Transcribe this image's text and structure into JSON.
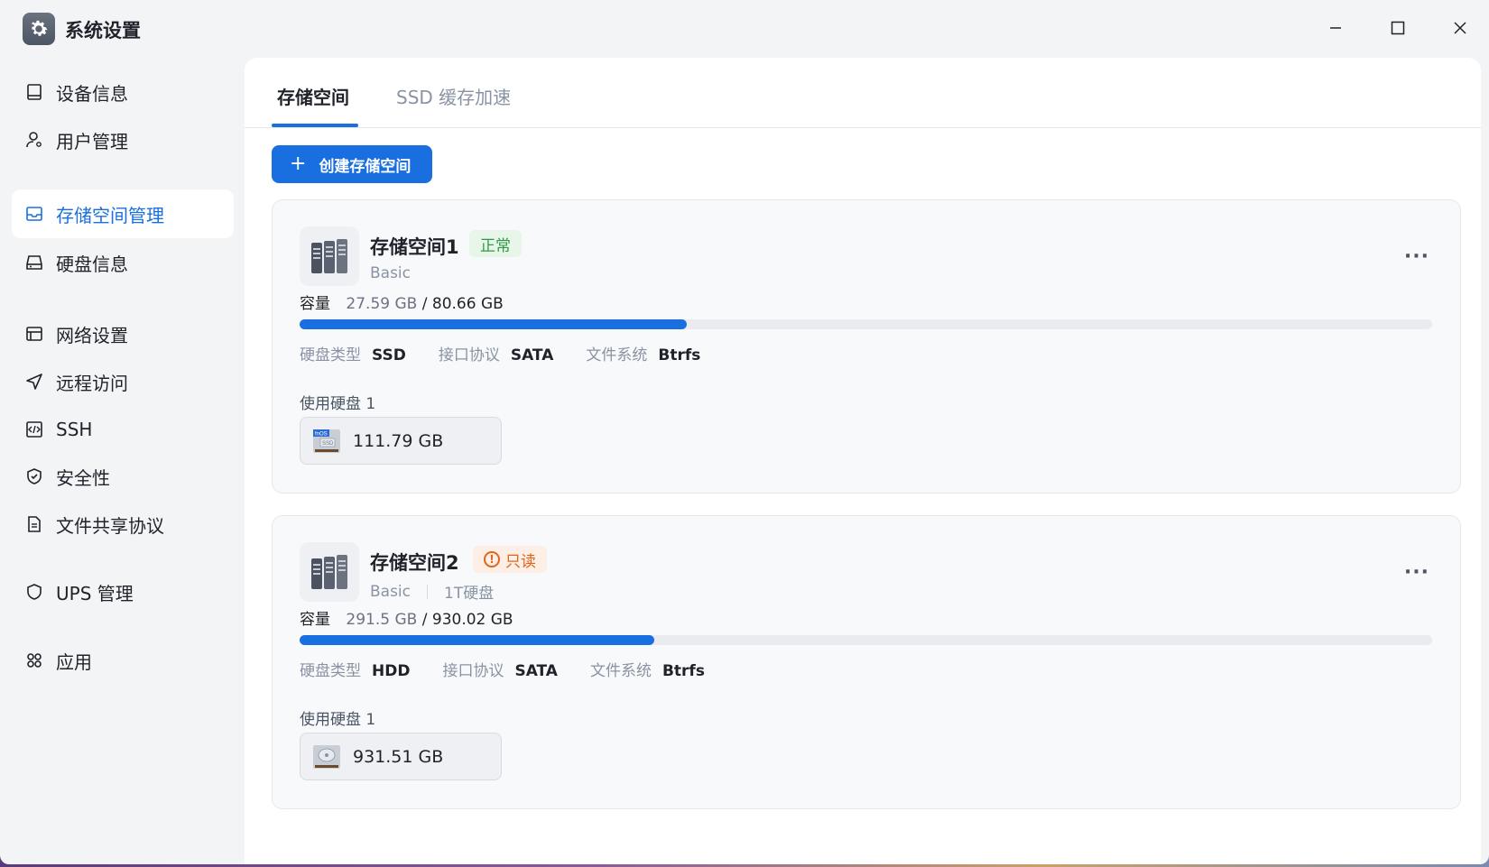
{
  "window": {
    "title": "系统设置",
    "icons": {
      "app": "gear-icon",
      "minimize": "minimize-icon",
      "maximize": "maximize-icon",
      "close": "close-icon"
    }
  },
  "sidebar": {
    "items": [
      {
        "label": "设备信息",
        "icon": "device-icon",
        "active": false
      },
      {
        "label": "用户管理",
        "icon": "user-icon",
        "active": false
      },
      {
        "label": "存储空间管理",
        "icon": "storage-icon",
        "active": true
      },
      {
        "label": "硬盘信息",
        "icon": "harddisk-icon",
        "active": false
      },
      {
        "label": "网络设置",
        "icon": "network-icon",
        "active": false
      },
      {
        "label": "远程访问",
        "icon": "send-icon",
        "active": false
      },
      {
        "label": "SSH",
        "icon": "code-icon",
        "active": false
      },
      {
        "label": "安全性",
        "icon": "shield-check-icon",
        "active": false
      },
      {
        "label": "文件共享协议",
        "icon": "document-icon",
        "active": false
      },
      {
        "label": "UPS 管理",
        "icon": "shield-icon",
        "active": false
      },
      {
        "label": "应用",
        "icon": "apps-icon",
        "active": false
      }
    ]
  },
  "tabs": [
    {
      "label": "存储空间",
      "active": true
    },
    {
      "label": "SSD 缓存加速",
      "active": false
    }
  ],
  "create_button": {
    "icon": "plus-icon",
    "label": "创建存储空间"
  },
  "pools": [
    {
      "name": "存储空间1",
      "status": "正常",
      "status_color": "#2f9a45",
      "raid": "Basic",
      "extra": "",
      "capacity_label": "容量",
      "used": "27.59 GB",
      "separator": "/",
      "total": "80.66 GB",
      "usage_fraction": 0.342,
      "specs": [
        {
          "k": "硬盘类型",
          "v": "SSD"
        },
        {
          "k": "接口协议",
          "v": "SATA"
        },
        {
          "k": "文件系统",
          "v": "Btrfs"
        }
      ],
      "disk_count_label": "使用硬盘 1",
      "disk": {
        "size": "111.79 GB",
        "icon": "ssd-icon",
        "icon_text": "fnOS SSD"
      },
      "more": "···"
    },
    {
      "name": "存储空间2",
      "status": "只读",
      "status_color": "#e0651b",
      "raid": "Basic",
      "extra": "1T硬盘",
      "capacity_label": "容量",
      "used": "291.5 GB",
      "separator": "/",
      "total": "930.02 GB",
      "usage_fraction": 0.313,
      "specs": [
        {
          "k": "硬盘类型",
          "v": "HDD"
        },
        {
          "k": "接口协议",
          "v": "SATA"
        },
        {
          "k": "文件系统",
          "v": "Btrfs"
        }
      ],
      "disk_count_label": "使用硬盘 1",
      "disk": {
        "size": "931.51 GB",
        "icon": "hdd-icon"
      },
      "more": "···"
    }
  ],
  "colors": {
    "accent": "#1a6fe0",
    "ok": "#2f9a45",
    "warn": "#e0651b"
  }
}
